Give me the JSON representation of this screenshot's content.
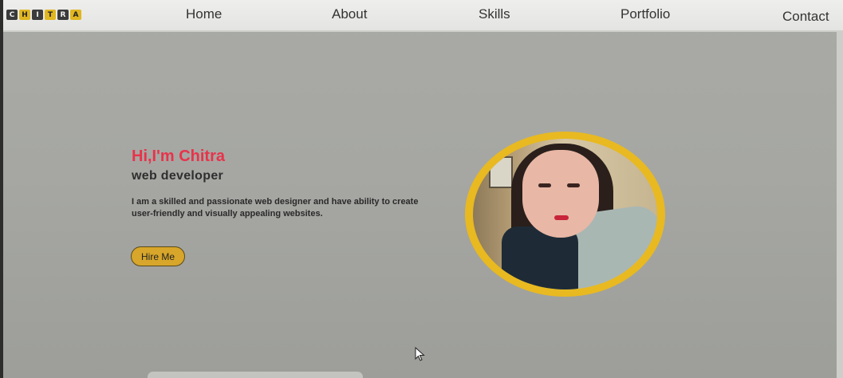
{
  "logo": {
    "letters": [
      "C",
      "H",
      "I",
      "T",
      "R",
      "A"
    ]
  },
  "nav": {
    "home": "Home",
    "about": "About",
    "skills": "Skills",
    "portfolio": "Portfolio",
    "contact": "Contact"
  },
  "hero": {
    "greeting": "Hi,I'm Chitra",
    "role": "web developer",
    "description": "I am a skilled and passionate web designer and have ability to create user-friendly and visually appealing websites.",
    "hire_button": "Hire Me"
  },
  "colors": {
    "accent": "#e8334a",
    "brand_yellow": "#e0b621",
    "button": "#d7a62a",
    "background": "#a7a8a4"
  },
  "icons": {
    "cursor": "mouse-pointer-icon"
  }
}
